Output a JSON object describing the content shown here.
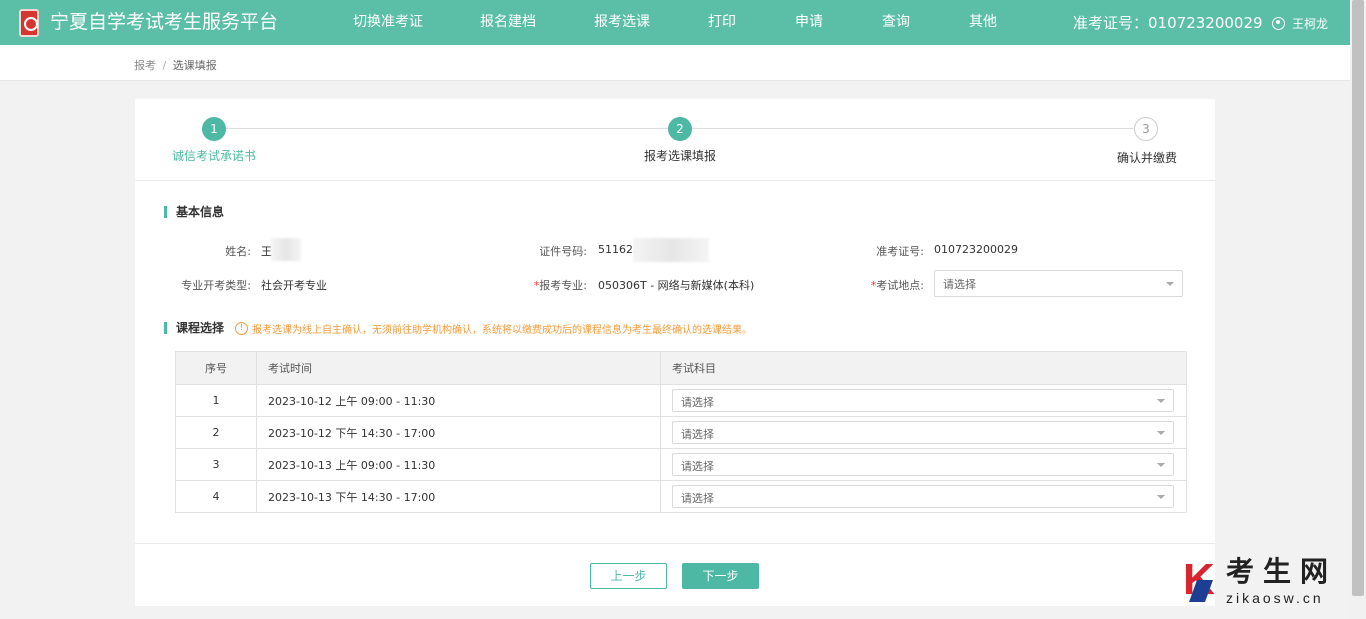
{
  "header": {
    "site_title": "宁夏自学考试考生服务平台",
    "nav": [
      "切换准考证",
      "报名建档",
      "报考选课",
      "打印",
      "申请",
      "查询",
      "其他"
    ],
    "ticket_label": "准考证号：",
    "ticket_number": "010723200029",
    "user_name": "王柯龙",
    "icons": {
      "logo": "seal-logo-icon",
      "user": "user-icon"
    }
  },
  "breadcrumb": {
    "root": "报考",
    "sep": "/",
    "current": "选课填报"
  },
  "steps": [
    {
      "num": "1",
      "label": "诚信考试承诺书",
      "state": "done"
    },
    {
      "num": "2",
      "label": "报考选课填报",
      "state": "active"
    },
    {
      "num": "3",
      "label": "确认并缴费",
      "state": "todo"
    }
  ],
  "basic_info": {
    "title": "基本信息",
    "name_label": "姓名:",
    "name_value": "王",
    "id_label": "证件号码:",
    "id_value": "511623",
    "ticket_label": "准考证号:",
    "ticket_value": "010723200029",
    "type_label": "专业开考类型:",
    "type_value": "社会开考专业",
    "major_label": "报考专业:",
    "major_value": "050306T - 网络与新媒体(本科)",
    "location_label": "考试地点:",
    "location_placeholder": "请选择"
  },
  "courses": {
    "title": "课程选择",
    "notice": "报考选课为线上自主确认，无须前往助学机构确认，系统将以缴费成功后的课程信息为考生最终确认的选课结果。",
    "headers": [
      "序号",
      "考试时间",
      "考试科目"
    ],
    "rows": [
      {
        "no": "1",
        "time": "2023-10-12 上午 09:00 - 11:30",
        "subject": "请选择"
      },
      {
        "no": "2",
        "time": "2023-10-12 下午 14:30 - 17:00",
        "subject": "请选择"
      },
      {
        "no": "3",
        "time": "2023-10-13 上午 09:00 - 11:30",
        "subject": "请选择"
      },
      {
        "no": "4",
        "time": "2023-10-13 下午 14:30 - 17:00",
        "subject": "请选择"
      }
    ]
  },
  "buttons": {
    "prev": "上一步",
    "next": "下一步"
  },
  "watermark": {
    "letter": "K",
    "cn": "考生网",
    "en": "zikaosw.cn"
  },
  "colors": {
    "accent": "#5bbfa8",
    "step_done": "#4db9a4",
    "notice": "#f39c3b",
    "required": "#e33333"
  }
}
